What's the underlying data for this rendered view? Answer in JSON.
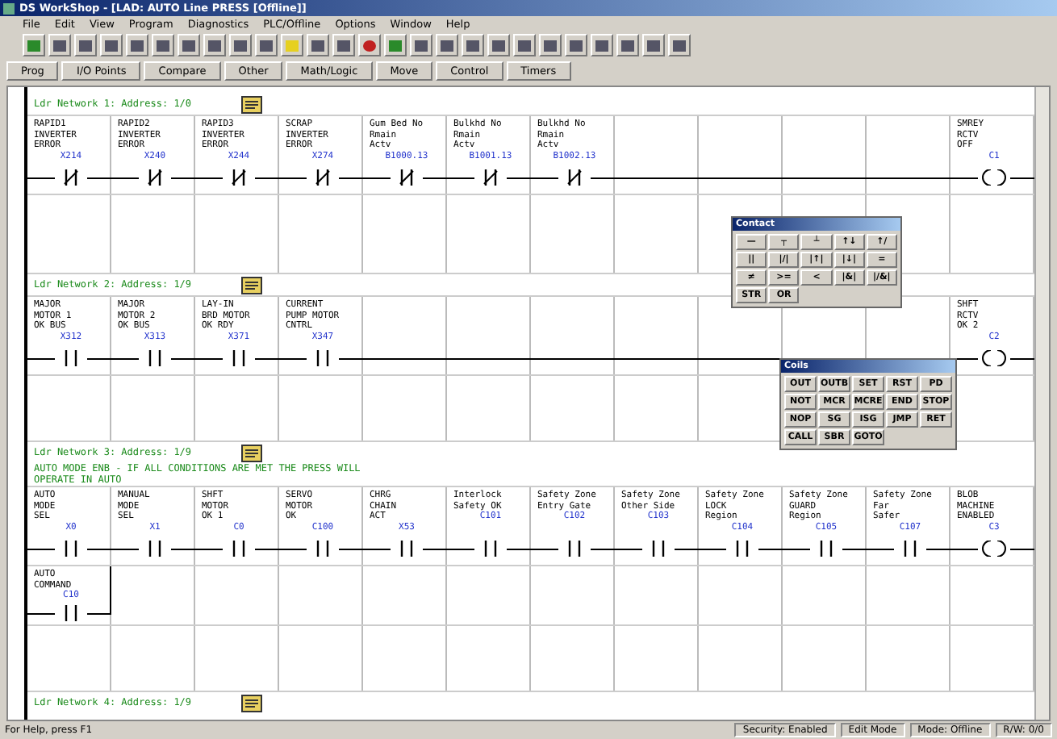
{
  "window": {
    "title": "DS WorkShop - [LAD: AUTO Line PRESS [Offline]]"
  },
  "menu": [
    "File",
    "Edit",
    "View",
    "Program",
    "Diagnostics",
    "PLC/Offline",
    "Options",
    "Window",
    "Help"
  ],
  "instruction_tabs": [
    "Prog",
    "I/O Points",
    "Compare",
    "Other",
    "Math/Logic",
    "Move",
    "Control",
    "Timers"
  ],
  "rungs": [
    {
      "header": "Ldr Network 1: Address: 1/0",
      "contacts": [
        {
          "lines": [
            "RAPID1",
            "INVERTER",
            "ERROR"
          ],
          "address": "X214",
          "kind": "nc"
        },
        {
          "lines": [
            "RAPID2",
            "INVERTER",
            "ERROR"
          ],
          "address": "X240",
          "kind": "nc"
        },
        {
          "lines": [
            "RAPID3",
            "INVERTER",
            "ERROR"
          ],
          "address": "X244",
          "kind": "nc"
        },
        {
          "lines": [
            "SCRAP",
            "INVERTER",
            "ERROR"
          ],
          "address": "X274",
          "kind": "nc"
        },
        {
          "lines": [
            "Gum Bed No",
            "Rmain",
            "Actv"
          ],
          "address": "B1000.13",
          "kind": "nc"
        },
        {
          "lines": [
            "Bulkhd No",
            "Rmain",
            "Actv"
          ],
          "address": "B1001.13",
          "kind": "nc"
        },
        {
          "lines": [
            "Bulkhd No",
            "Rmain",
            "Actv"
          ],
          "address": "B1002.13",
          "kind": "nc"
        }
      ],
      "coil": {
        "lines": [
          "SMREY",
          "RCTV",
          "OFF"
        ],
        "address": "C1"
      }
    },
    {
      "header": "Ldr Network 2: Address: 1/9",
      "contacts": [
        {
          "lines": [
            "MAJOR",
            "MOTOR 1",
            "OK BUS"
          ],
          "address": "X312",
          "kind": "no"
        },
        {
          "lines": [
            "MAJOR",
            "MOTOR 2",
            "OK BUS"
          ],
          "address": "X313",
          "kind": "no"
        },
        {
          "lines": [
            "LAY-IN",
            "BRD MOTOR",
            "OK RDY"
          ],
          "address": "X371",
          "kind": "no"
        },
        {
          "lines": [
            "CURRENT",
            "PUMP MOTOR",
            "CNTRL"
          ],
          "address": "X347",
          "kind": "no"
        }
      ],
      "coil": {
        "lines": [
          "SHFT",
          "RCTV",
          "OK 2"
        ],
        "address": "C2"
      }
    },
    {
      "header": "Ldr Network 3: Address: 1/9",
      "comment": [
        "AUTO MODE ENB - IF ALL CONDITIONS ARE MET THE PRESS WILL",
        "OPERATE IN AUTO"
      ],
      "contacts": [
        {
          "lines": [
            "AUTO",
            "MODE",
            "SEL"
          ],
          "address": "X0",
          "kind": "no"
        },
        {
          "lines": [
            "MANUAL",
            "MODE",
            "SEL"
          ],
          "address": "X1",
          "kind": "no"
        },
        {
          "lines": [
            "SHFT",
            "MOTOR",
            "OK 1"
          ],
          "address": "C0",
          "kind": "no"
        },
        {
          "lines": [
            "SERVO",
            "MOTOR",
            "OK"
          ],
          "address": "C100",
          "kind": "no"
        },
        {
          "lines": [
            "CHRG",
            "CHAIN",
            "ACT"
          ],
          "address": "X53",
          "kind": "no"
        },
        {
          "lines": [
            "Interlock",
            "Safety OK"
          ],
          "address": "C101",
          "kind": "no"
        },
        {
          "lines": [
            "Safety Zone",
            "Entry Gate"
          ],
          "address": "C102",
          "kind": "no"
        },
        {
          "lines": [
            "Safety Zone",
            "Other Side"
          ],
          "address": "C103",
          "kind": "no"
        },
        {
          "lines": [
            "Safety Zone",
            "LOCK",
            "Region"
          ],
          "address": "C104",
          "kind": "no"
        },
        {
          "lines": [
            "Safety Zone",
            "GUARD",
            "Region"
          ],
          "address": "C105",
          "kind": "no"
        },
        {
          "lines": [
            "Safety Zone",
            "Far",
            "Safer"
          ],
          "address": "C107",
          "kind": "no"
        }
      ],
      "coil": {
        "lines": [
          "BLOB",
          "MACHINE",
          "ENABLED"
        ],
        "address": "C3"
      },
      "branch": [
        {
          "lines": [
            "AUTO",
            "COMMAND"
          ],
          "address": "C10",
          "kind": "no"
        }
      ]
    },
    {
      "header": "Ldr Network 4: Address: 1/9"
    }
  ],
  "contact_palette": {
    "title": "Contact",
    "buttons": [
      "—",
      "┬",
      "┴",
      "↑↓",
      "↑/",
      "||",
      "|/|",
      "|↑|",
      "|↓|",
      "=",
      "≠",
      ">=",
      "<",
      "|&|",
      "|/&|",
      "STR",
      "OR"
    ]
  },
  "coil_palette": {
    "title": "Coils",
    "buttons": [
      "OUT",
      "OUTB",
      "SET",
      "RST",
      "PD",
      "NOT",
      "MCR",
      "MCRE",
      "END",
      "STOP",
      "NOP",
      "SG",
      "ISG",
      "JMP",
      "RET",
      "CALL",
      "SBR",
      "GOTO"
    ]
  },
  "status_bar": {
    "help": "For Help, press F1",
    "panes": [
      "Security: Enabled",
      "Edit Mode",
      "Mode: Offline",
      "R/W: 0/0"
    ]
  }
}
